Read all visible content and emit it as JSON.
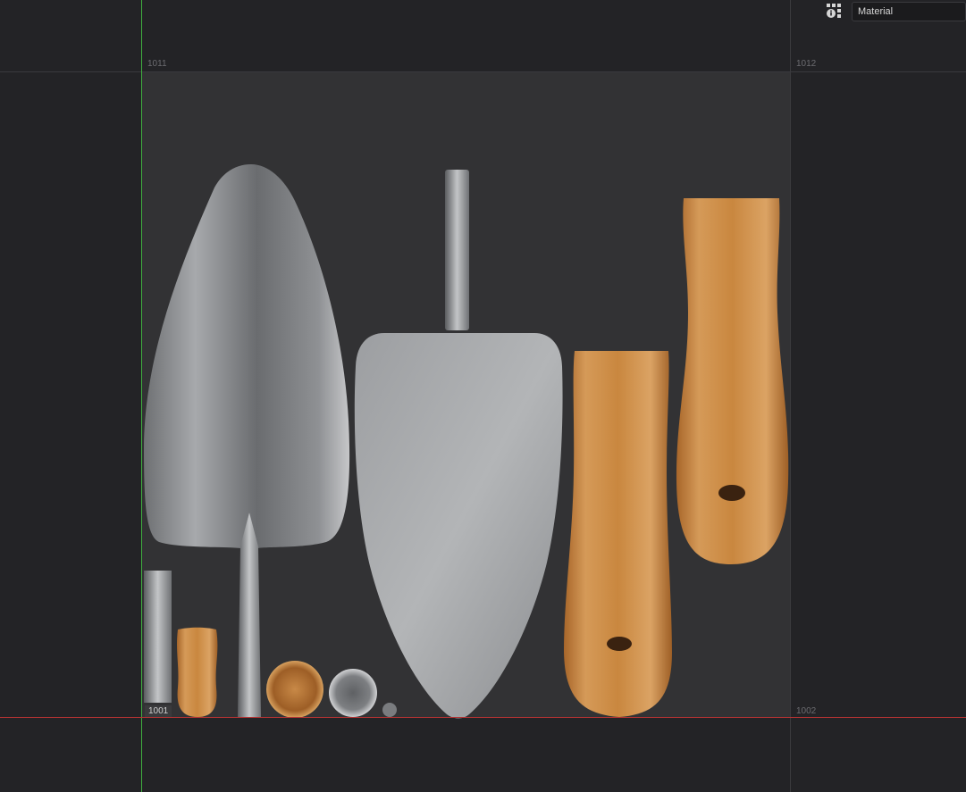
{
  "toolbar": {
    "info_icon": "uv-info-grid-icon",
    "material_dropdown": {
      "selected": "Material"
    }
  },
  "tiles": {
    "labels": [
      "1011",
      "1012",
      "1001",
      "1002"
    ],
    "active": "1001"
  },
  "uv_islands": [
    "trowel-blade-back",
    "trowel-blade-front",
    "trowel-shank",
    "handle-front",
    "handle-back",
    "ferrule-strip",
    "handle-end-strip",
    "handle-cap",
    "ferrule-cap",
    "rivet-cap"
  ],
  "colors": {
    "background": "#232326",
    "tile": "#323234",
    "u_axis": "#b53333",
    "v_axis": "#3fae3f",
    "metal": "#8c8e91",
    "wood": "#c98a46"
  }
}
